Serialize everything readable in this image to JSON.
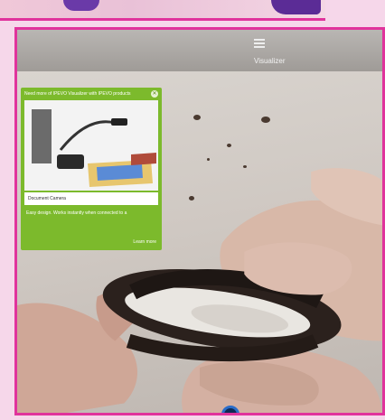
{
  "tablet": {
    "title": "Visualizer"
  },
  "ad": {
    "headline": "Need more of IPEVO Visualizer with IPEVO products",
    "caption": "Document Camera",
    "body": "Easy design. Works instantly when connected to a",
    "link": "Learn more",
    "close_symbol": "✕"
  },
  "icons": {
    "menu": "menu-icon",
    "close": "close-icon",
    "record": "record-icon"
  },
  "colors": {
    "frame_border": "#e0339c",
    "ad_green": "#7cba2c",
    "record_blue": "#2a6cc9"
  }
}
